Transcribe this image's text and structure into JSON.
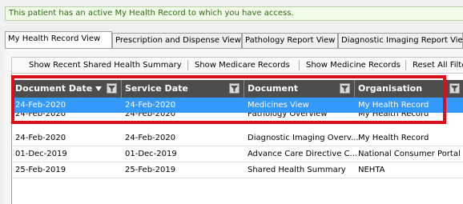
{
  "notice": {
    "text": "This patient has an active My Health Record to which you have access."
  },
  "tabs": [
    {
      "label": "My Health Record View",
      "active": true
    },
    {
      "label": "Prescription and Dispense View",
      "active": false
    },
    {
      "label": "Pathology Report View",
      "active": false
    },
    {
      "label": "Diagnostic Imaging Report View",
      "active": false
    }
  ],
  "toolbar": {
    "buttons": [
      "Show Recent Shared Health Summary",
      "Show Medicare Records",
      "Show Medicine Records",
      "Reset All Filters"
    ]
  },
  "table": {
    "columns": [
      "Document Date",
      "Service Date",
      "Document",
      "Organisation"
    ],
    "rows": [
      {
        "document_date": "24-Feb-2020",
        "service_date": "24-Feb-2020",
        "document": "Medicines View",
        "organisation": "My Health Record",
        "selected": true
      },
      {
        "document_date": "24-Feb-2020",
        "service_date": "24-Feb-2020",
        "document": "Pathology Overview",
        "organisation": "My Health Record",
        "selected": false
      },
      {
        "document_date": "24-Feb-2020",
        "service_date": "24-Feb-2020",
        "document": "Diagnostic Imaging Overv...",
        "organisation": "My Health Record",
        "selected": false
      },
      {
        "document_date": "01-Dec-2019",
        "service_date": "01-Dec-2019",
        "document": "Advance Care Directive C...",
        "organisation": "National Consumer Portal",
        "selected": false
      },
      {
        "document_date": "25-Feb-2019",
        "service_date": "25-Feb-2019",
        "document": "Shared Health Summary",
        "organisation": "NEHTA",
        "selected": false
      }
    ]
  },
  "colors": {
    "header_bg": "#4d4d4d",
    "selection": "#3399ff",
    "highlight_border": "#dc0e1c",
    "notice_text": "#2d6a12"
  },
  "icons": [
    "filter-icon",
    "sort-descending-icon"
  ]
}
